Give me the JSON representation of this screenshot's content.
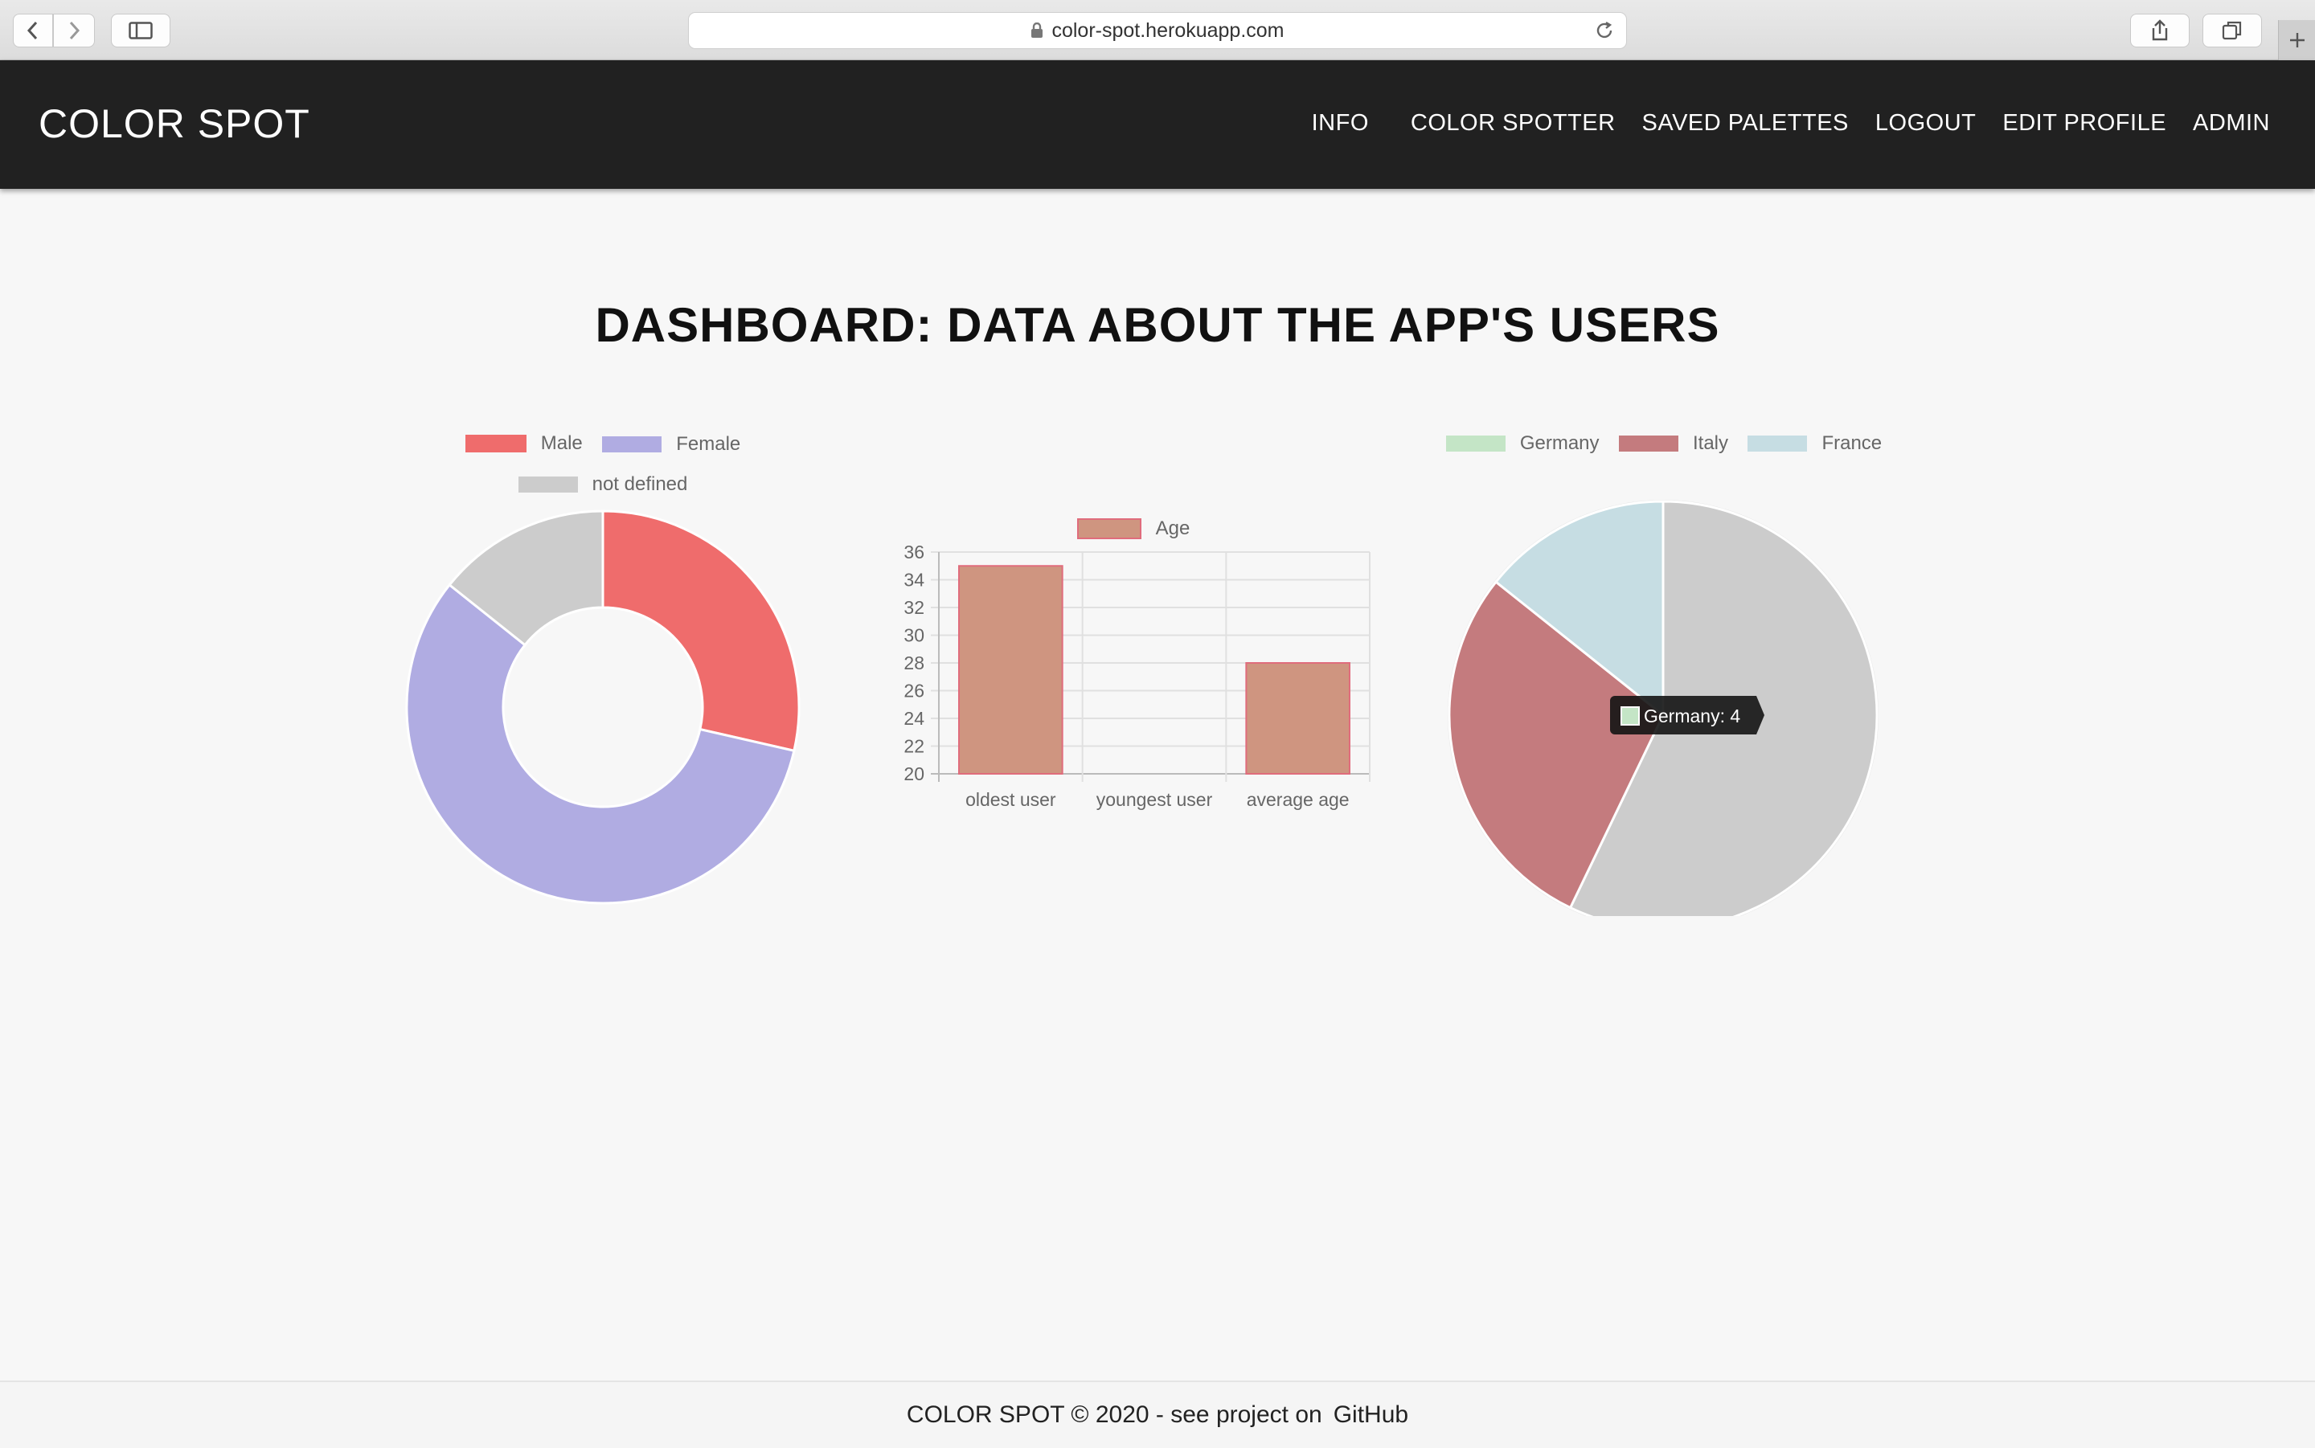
{
  "browser": {
    "url": "color-spot.herokuapp.com"
  },
  "navbar": {
    "brand": "COLOR SPOT",
    "links": [
      "INFO",
      "COLOR SPOTTER",
      "SAVED PALETTES",
      "LOGOUT",
      "EDIT PROFILE",
      "ADMIN"
    ]
  },
  "page": {
    "title": "DASHBOARD: DATA ABOUT THE APP'S USERS"
  },
  "chart_data": [
    {
      "type": "pie",
      "variant": "doughnut",
      "labels": [
        "Male",
        "Female",
        "not defined"
      ],
      "values": [
        2,
        4,
        1
      ],
      "colors": [
        "#ef6c6c",
        "#b0ace2",
        "#cccccc"
      ],
      "legend": "top"
    },
    {
      "type": "bar",
      "categories": [
        "oldest user",
        "youngest user",
        "average age"
      ],
      "series": [
        {
          "name": "Age",
          "values": [
            35,
            20,
            28
          ]
        }
      ],
      "ylim": [
        20,
        36
      ],
      "yticks": [
        20,
        22,
        24,
        26,
        28,
        30,
        32,
        34,
        36
      ],
      "colors": {
        "fill": "#cf9580",
        "border": "#e06c7c"
      },
      "grid": true,
      "legend": "top"
    },
    {
      "type": "pie",
      "labels": [
        "Germany",
        "Italy",
        "France"
      ],
      "values": [
        4,
        2,
        1
      ],
      "colors": [
        "#cccccc",
        "#c47b7e",
        "#c6dde3"
      ],
      "legend_colors": [
        "#c4e5c6",
        "#c47b7e",
        "#c6dde3"
      ],
      "legend": "top",
      "tooltip": "Germany: 4"
    }
  ],
  "footer": {
    "text": "COLOR SPOT © 2020 - see project on",
    "link": "GitHub"
  }
}
